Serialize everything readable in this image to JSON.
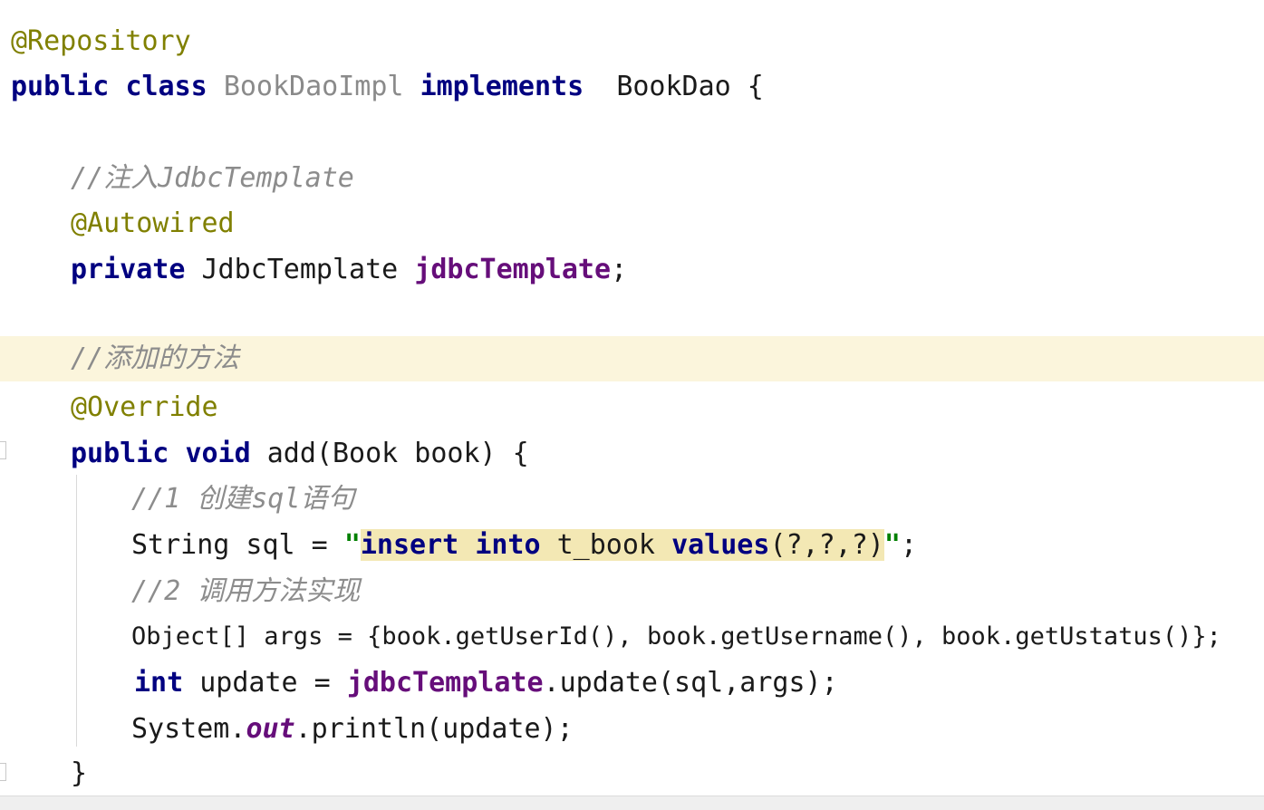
{
  "code": {
    "annotation_repository": "@Repository",
    "kw_public": "public",
    "kw_class": "class",
    "class_name": "BookDaoImpl",
    "kw_implements": "implements",
    "interface_name": "BookDao",
    "open_brace": " {",
    "comment_inject": "//注入JdbcTemplate",
    "annotation_autowired": "@Autowired",
    "kw_private": "private",
    "type_jdbc": " JdbcTemplate ",
    "field_jdbc": "jdbcTemplate",
    "semicolon": ";",
    "comment_add": "//添加的方法",
    "annotation_override": "@Override",
    "kw_void": "void",
    "method_sig": " add(Book book) {",
    "comment_1": "//1 创建sql语句",
    "sql_decl": "String sql = ",
    "quote_open": "\"",
    "sql_insert": "insert",
    "sql_into": "into",
    "sql_table": "t_book",
    "sql_values": "values",
    "sql_params": "(?,?,?)",
    "quote_close": "\"",
    "comment_2": "//2 调用方法实现",
    "args_line": "Object[] args = {book.getUserId(), book.getUsername(), book.getUstatus()};",
    "kw_int": "int",
    "update_decl": " update = ",
    "update_call": ".update(sql,args);",
    "system_prefix": "System.",
    "static_out": "out",
    "println_call": ".println(update);",
    "close_brace": "}"
  }
}
